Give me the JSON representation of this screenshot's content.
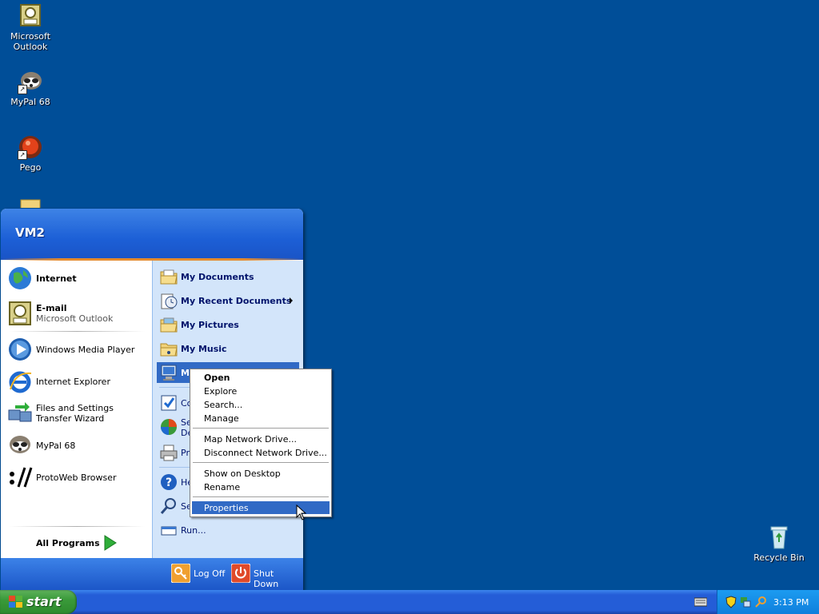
{
  "desktop": {
    "icons": [
      {
        "label": "Microsoft\nOutlook",
        "name": "outlook-icon"
      },
      {
        "label": "MyPal 68",
        "name": "mypal-icon"
      },
      {
        "label": "Pego",
        "name": "pego-icon"
      },
      {
        "label": "Recycle Bin",
        "name": "recycle-bin-icon"
      }
    ],
    "background_color": "#004e98"
  },
  "start_menu": {
    "user_name": "VM2",
    "pinned": [
      {
        "label": "Internet",
        "icon": "globe-icon"
      },
      {
        "label": "E-mail",
        "sub": "Microsoft Outlook",
        "icon": "outlook-icon"
      }
    ],
    "recent": [
      {
        "label": "Windows Media Player",
        "icon": "media-player-icon"
      },
      {
        "label": "Internet Explorer",
        "icon": "ie-icon"
      },
      {
        "label": "Files and Settings Transfer Wizard",
        "icon": "transfer-wizard-icon"
      },
      {
        "label": "MyPal 68",
        "icon": "mypal-icon"
      },
      {
        "label": "ProtoWeb Browser",
        "icon": "protoweb-icon"
      }
    ],
    "all_programs": "All Programs",
    "places": [
      {
        "label": "My Documents",
        "icon": "folder-icon"
      },
      {
        "label": "My Recent Documents",
        "icon": "recent-docs-icon"
      },
      {
        "label": "My Pictures",
        "icon": "folder-icon"
      },
      {
        "label": "My Music",
        "icon": "folder-icon"
      },
      {
        "label": "M",
        "icon": "my-computer-icon"
      }
    ],
    "places2": [
      {
        "label": "Co",
        "icon": "control-panel-icon"
      },
      {
        "label": "Se\nDe",
        "icon": "set-program-defaults-icon"
      },
      {
        "label": "Pr",
        "icon": "printer-icon"
      }
    ],
    "places3": [
      {
        "label": "He",
        "icon": "help-icon"
      },
      {
        "label": "Se",
        "icon": "search-icon"
      },
      {
        "label": "Run...",
        "icon": "run-icon"
      }
    ],
    "log_off": "Log Off",
    "shut_down": "Shut Down"
  },
  "context_menu": {
    "group1": [
      "Open",
      "Explore",
      "Search...",
      "Manage"
    ],
    "group2": [
      "Map Network Drive...",
      "Disconnect Network Drive..."
    ],
    "group3": [
      "Show on Desktop",
      "Rename"
    ],
    "group4": [
      "Properties"
    ]
  },
  "taskbar": {
    "start_label": "start",
    "clock": "3:13 PM"
  },
  "colors": {
    "selection": "#316ac5",
    "taskbar": "#245dd7",
    "start_button": "#3a9a3a"
  }
}
